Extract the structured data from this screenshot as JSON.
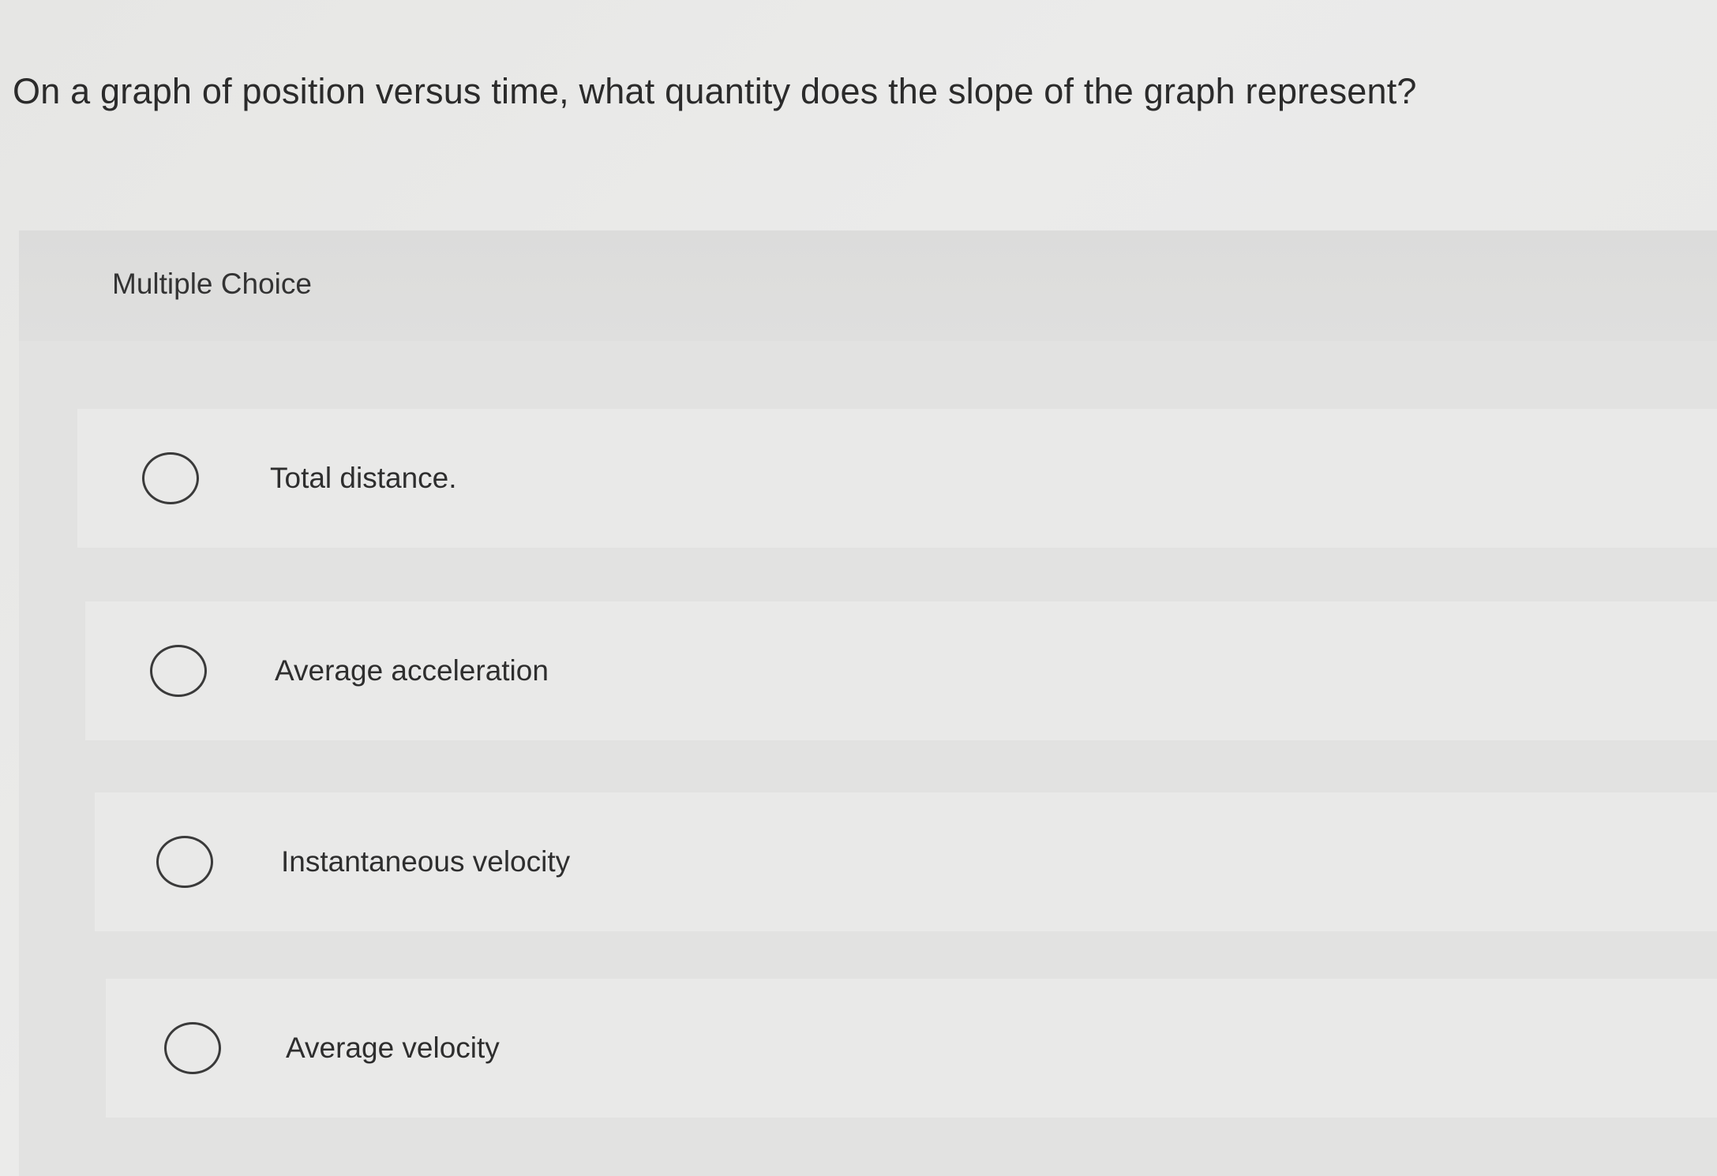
{
  "question": {
    "text": "On a graph of position versus time, what quantity does the slope of the graph represent?"
  },
  "multiple_choice": {
    "label": "Multiple Choice",
    "options": [
      {
        "label": "Total distance.",
        "selected": false
      },
      {
        "label": "Average acceleration",
        "selected": false
      },
      {
        "label": "Instantaneous velocity",
        "selected": false
      },
      {
        "label": "Average velocity",
        "selected": false
      }
    ]
  },
  "colors": {
    "background": "#e9e9e8",
    "panel": "#e2e2e1",
    "text": "#2b2b2b",
    "radio_border": "#3a3a3a"
  }
}
